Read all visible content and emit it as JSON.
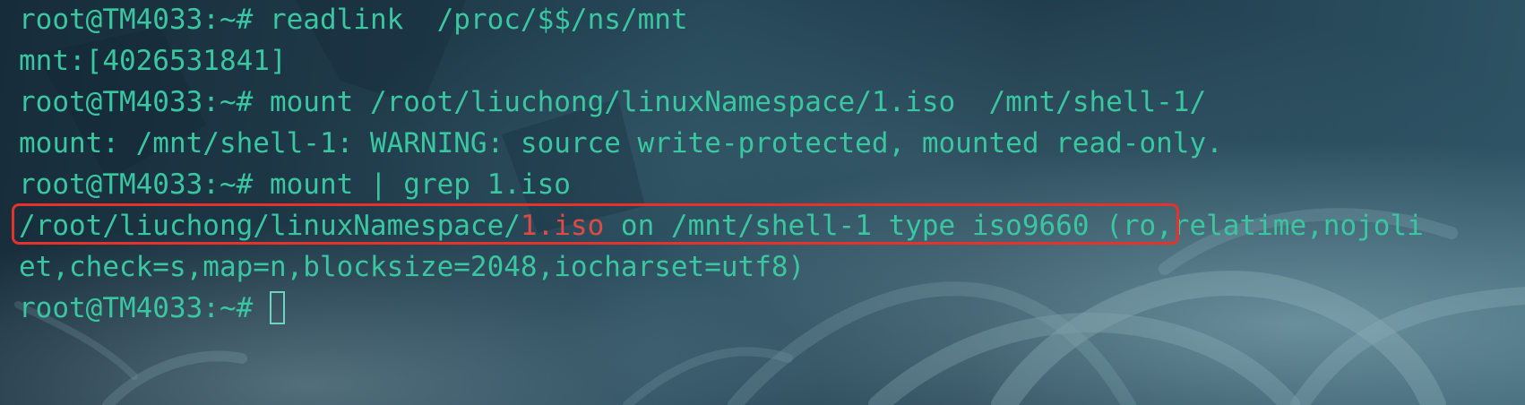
{
  "terminal": {
    "lines": [
      {
        "prompt": "root@TM4033:~# ",
        "command": "readlink  /proc/$$/ns/mnt"
      },
      {
        "output": "mnt:[4026531841]"
      },
      {
        "prompt": "root@TM4033:~# ",
        "command": "mount /root/liuchong/linuxNamespace/1.iso  /mnt/shell-1/"
      },
      {
        "output": "mount: /mnt/shell-1: WARNING: source write-protected, mounted read-only."
      },
      {
        "prompt": "root@TM4033:~# ",
        "command": "mount | grep 1.iso"
      },
      {
        "output_prefix": "/root/liuchong/linuxNamespace/",
        "output_match": "1.iso",
        "output_suffix": " on /mnt/shell-1 type iso9660 (ro,relatime,nojoli"
      },
      {
        "output": "et,check=s,map=n,blocksize=2048,iocharset=utf8)"
      },
      {
        "prompt": "root@TM4033:~# ",
        "command": ""
      }
    ]
  },
  "colors": {
    "text": "#3ac6a0",
    "grep_match": "#e04a44",
    "annotation_box": "#e4332b"
  }
}
